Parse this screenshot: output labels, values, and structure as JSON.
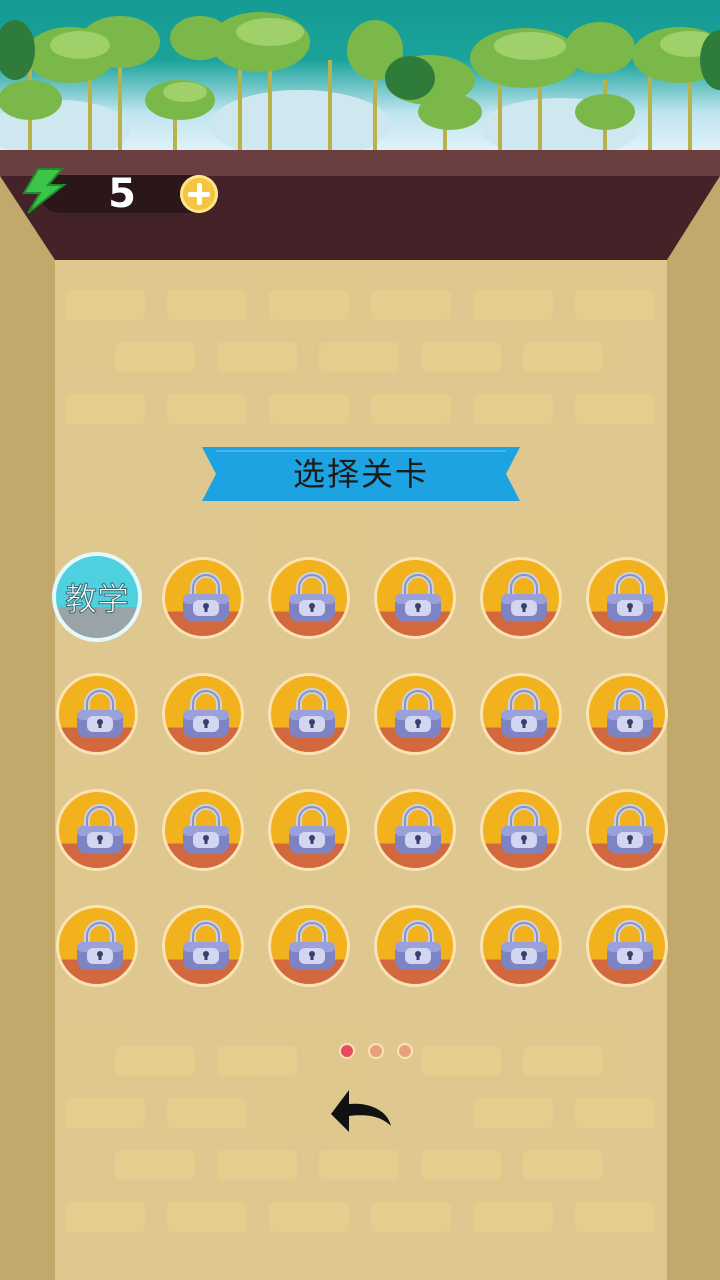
{
  "hud": {
    "energy_count": "5",
    "energy_icon": "lightning-icon",
    "add_icon": "plus-circle-icon"
  },
  "title": {
    "text": "选择关卡"
  },
  "levels": {
    "tutorial_label": "教学",
    "locked_icon": "padlock-icon",
    "rows": 4,
    "columns": 6,
    "locked_count": 23
  },
  "pagination": {
    "pages": 3,
    "current": 1
  },
  "navigation": {
    "back_icon": "back-arrow-icon"
  },
  "colors": {
    "accent_banner": "#1ea3e2",
    "level_coin": "#f2b21d",
    "active_dot": "#e84a5f",
    "inactive_dot": "#e9a07a",
    "energy_green": "#3cc54a"
  }
}
